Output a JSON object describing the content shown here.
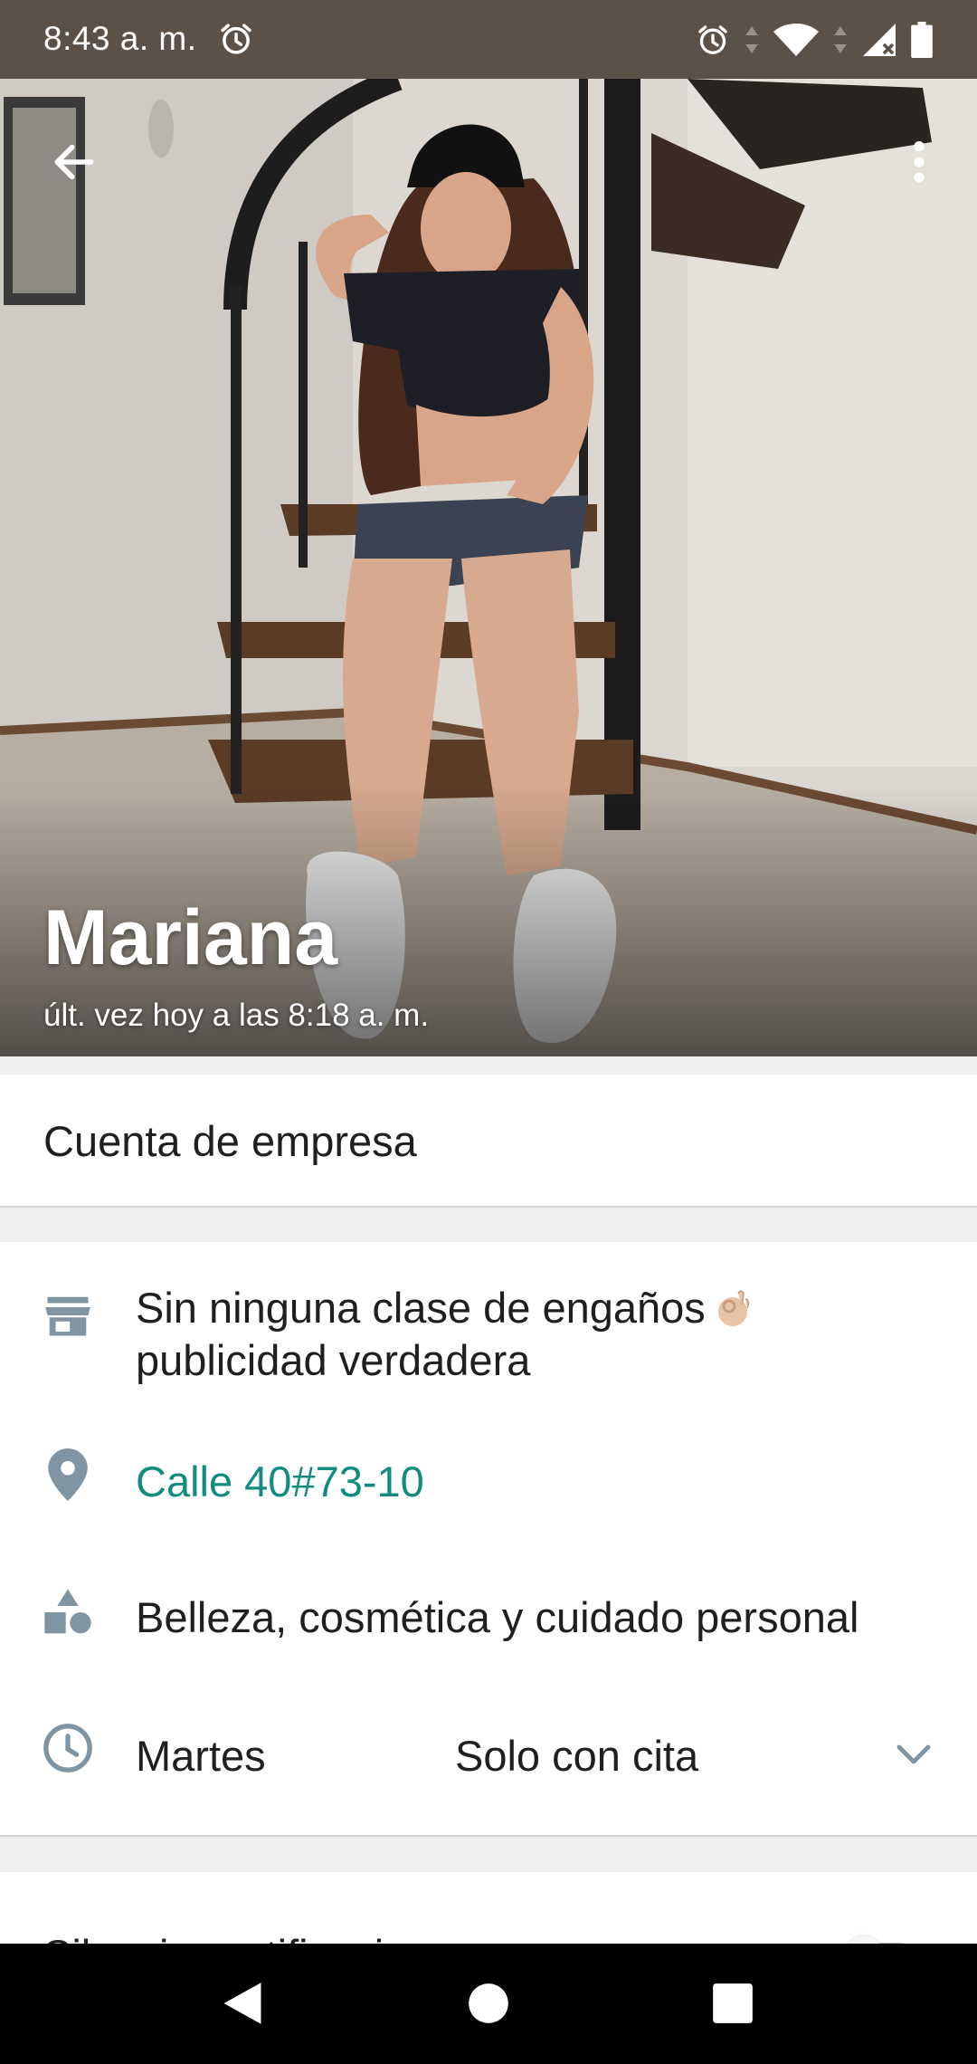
{
  "status_bar": {
    "time": "8:43 a. m.",
    "icons": [
      "alarm-icon",
      "wifi-icon",
      "cell-signal-icon",
      "battery-icon"
    ]
  },
  "header": {
    "contact_name": "Mariana",
    "last_seen": "últ. vez hoy a las 8:18 a. m.",
    "back_icon": "arrow-left-icon",
    "menu_icon": "more-vertical-icon"
  },
  "business": {
    "label": "Cuenta de empresa"
  },
  "info": {
    "description_line1": "Sin ninguna clase de engaños",
    "description_line2": "publicidad verdadera",
    "description_emoji": "ok-hand-emoji",
    "address": "Calle 40#73-10",
    "category": "Belleza, cosmética y cuidado personal",
    "hours_day": "Martes",
    "hours_value": "Solo con cita"
  },
  "mute": {
    "label": "Silenciar notificaciones",
    "enabled": false
  },
  "colors": {
    "status_bar": "#5b5147",
    "accent": "#128c7e",
    "icon_gray": "#7f95a4",
    "text": "#1f1f1f"
  },
  "nav_bar": {
    "icons": [
      "back-triangle-icon",
      "home-circle-icon",
      "recents-square-icon"
    ]
  }
}
